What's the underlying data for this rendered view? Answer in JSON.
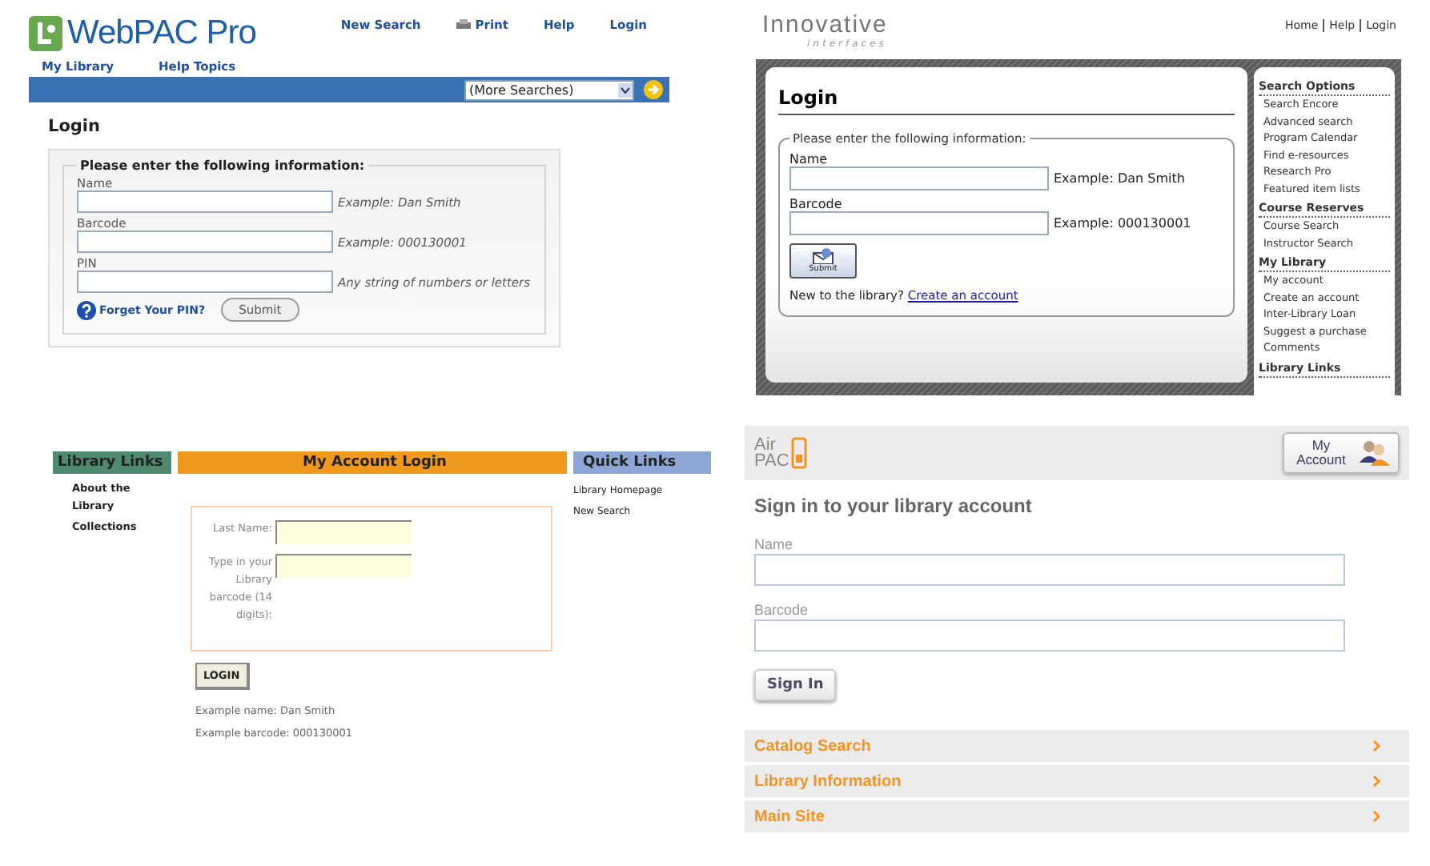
{
  "webpac": {
    "logo": "WebPAC Pro",
    "top_links": [
      "New Search",
      "Print",
      "Help",
      "Login"
    ],
    "sub_links": [
      "My Library",
      "Help Topics"
    ],
    "search_select": "(More Searches)",
    "heading": "Login",
    "legend": "Please enter the following information:",
    "fields": [
      {
        "label": "Name",
        "hint": "Example: Dan Smith"
      },
      {
        "label": "Barcode",
        "hint": "Example: 000130001"
      },
      {
        "label": "PIN",
        "hint": "Any string of numbers or letters"
      }
    ],
    "forgot_link": "Forget Your PIN?",
    "submit": "Submit"
  },
  "innovative": {
    "logo_main": "Innovative",
    "logo_sub": "interfaces",
    "top_links": [
      "Home",
      "Help",
      "Login"
    ],
    "heading": "Login",
    "legend": "Please enter the following information:",
    "fields": [
      {
        "label": "Name",
        "hint": "Example: Dan Smith"
      },
      {
        "label": "Barcode",
        "hint": "Example: 000130001"
      }
    ],
    "submit": "Submit",
    "new_prompt": "New to the library?",
    "create_link": "Create an account",
    "sidebar": [
      {
        "title": "Search Options",
        "items": [
          "Search Encore",
          "Advanced search",
          "Program Calendar",
          "Find e-resources",
          "Research Pro",
          "Featured item lists"
        ]
      },
      {
        "title": "Course Reserves",
        "items": [
          "Course Search",
          "Instructor Search"
        ]
      },
      {
        "title": "My Library",
        "items": [
          "My account",
          "Create an account",
          "Inter-Library Loan",
          "Suggest a purchase",
          "Comments"
        ]
      },
      {
        "title": "Library Links"
      }
    ]
  },
  "classic": {
    "left_title": "Library Links",
    "left_links": [
      "About the Library",
      "Collections"
    ],
    "center_title": "My Account Login",
    "fields": [
      {
        "label": "Last Name:"
      },
      {
        "label": "Type in your Library barcode (14 digits):"
      }
    ],
    "login_button": "LOGIN",
    "examples": [
      "Example name: Dan Smith",
      "Example barcode: 000130001"
    ],
    "right_title": "Quick Links",
    "right_links": [
      "Library Homepage",
      "New Search"
    ]
  },
  "airpac": {
    "logo_top": "Air",
    "logo_bottom": "PAC",
    "account_button": "My Account",
    "heading": "Sign in to your library account",
    "fields": [
      {
        "label": "Name"
      },
      {
        "label": "Barcode"
      }
    ],
    "sign_in": "Sign In",
    "menu": [
      "Catalog Search",
      "Library Information",
      "Main Site"
    ]
  }
}
